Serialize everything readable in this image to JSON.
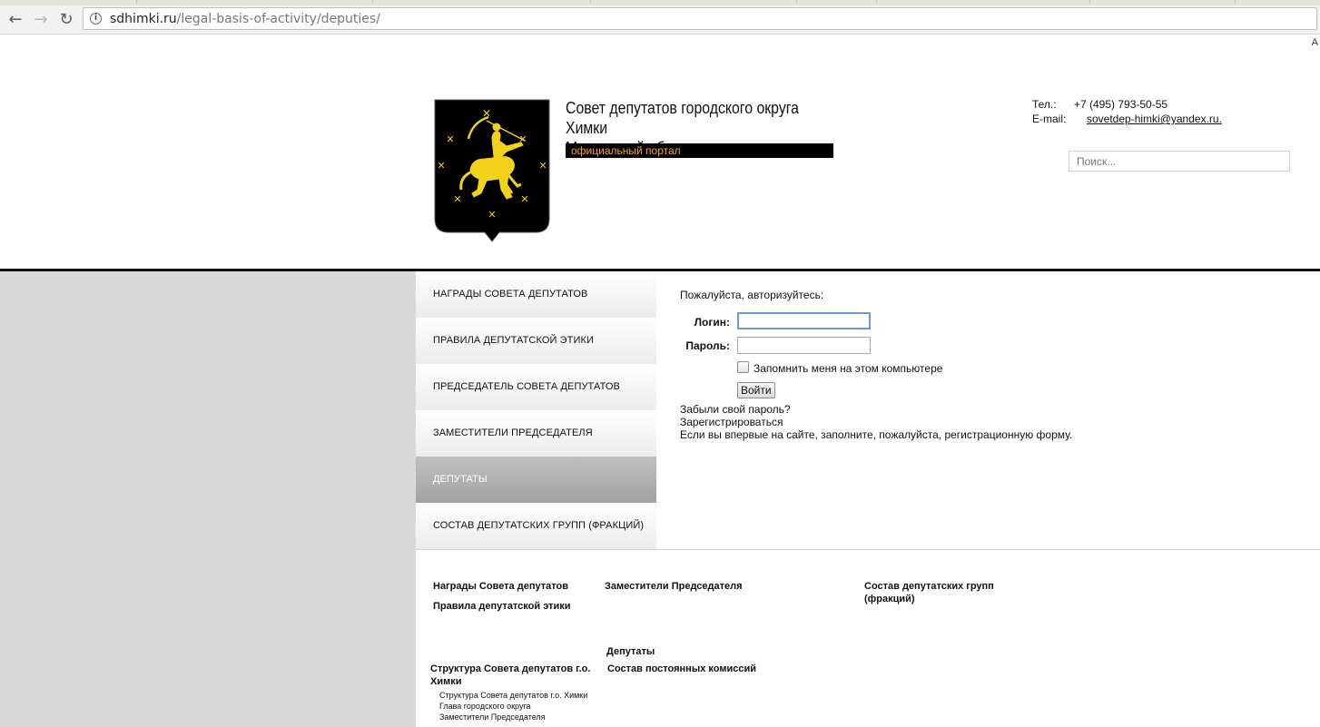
{
  "browser": {
    "url_host": "sdhimki.ru",
    "url_path": "/legal-basis-of-activity/deputies/",
    "edge_glyph": "A"
  },
  "header": {
    "title_line1": "Совет депутатов городского округа Химки",
    "title_line2": "Московской области",
    "portal_label": "официальный портал",
    "phone_label": "Тел.:",
    "phone": "+7 (495) 793-50-55",
    "email_label": "E-mail:",
    "email": "sovetdep-himki@yandex.ru.",
    "search_placeholder": "Поиск..."
  },
  "sidebar": {
    "items": [
      {
        "label": "НАГРАДЫ СОВЕТА ДЕПУТАТОВ",
        "active": false
      },
      {
        "label": "ПРАВИЛА ДЕПУТАТСКОЙ ЭТИКИ",
        "active": false
      },
      {
        "label": "ПРЕДСЕДАТЕЛЬ СОВЕТА ДЕПУТАТОВ",
        "active": false
      },
      {
        "label": "ЗАМЕСТИТЕЛИ ПРЕДСЕДАТЕЛЯ",
        "active": false
      },
      {
        "label": "ДЕПУТАТЫ",
        "active": true
      },
      {
        "label": "СОСТАВ ДЕПУТАТСКИХ ГРУПП (ФРАКЦИЙ)",
        "active": false
      }
    ]
  },
  "login": {
    "prompt": "Пожалуйста, авторизуйтесь:",
    "login_label": "Логин:",
    "password_label": "Пароль:",
    "remember_label": "Запомнить меня на этом компьютере",
    "submit_label": "Войти",
    "forgot_link": "Забыли свой пароль?",
    "register_link": "Зарегистрироваться",
    "register_note": "Если вы впервые на сайте, заполните, пожалуйста, регистрационную форму."
  },
  "sitemap": {
    "awards": "Награды Совета депутатов",
    "ethics": "Правила депутатской этики",
    "deputy_chairs": "Заместители Председателя",
    "factions": "Состав депутатских групп (фракций)",
    "deputies": "Депутаты",
    "structure": "Структура Совета депутатов г.о. Химки",
    "commissions": "Состав постоянных комиссий",
    "structure_sub": [
      "Структура Совета депутатов г.о. Химки",
      "Глава городского округа",
      "Заместители Председателя"
    ]
  },
  "colors": {
    "portal_bar_bg": "#000000",
    "portal_text": "#f5a623",
    "emblem_gold": "#f2d21b",
    "active_menu_bg": "#adadad",
    "left_pane_bg": "#d9d9d9"
  }
}
